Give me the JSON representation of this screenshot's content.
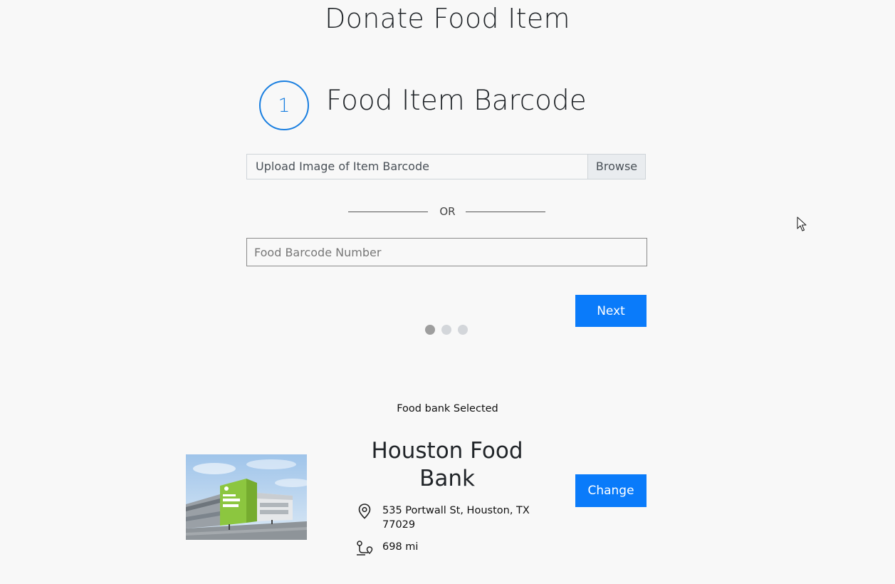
{
  "page": {
    "title": "Donate Food Item"
  },
  "step": {
    "number": "1",
    "title": "Food Item Barcode",
    "upload": {
      "label": "Upload Image of Item Barcode",
      "browse": "Browse"
    },
    "divider": "OR",
    "barcode_input": {
      "placeholder": "Food Barcode Number",
      "value": ""
    },
    "next": "Next",
    "pagination": {
      "total": 3,
      "active": 1
    }
  },
  "foodbank": {
    "selected_label": "Food bank Selected",
    "name": "Houston Food Bank",
    "address": "535 Portwall St, Houston, TX 77029",
    "distance": "698 mi",
    "change": "Change",
    "image_icon": "foodbank-building-photo"
  },
  "icons": {
    "address": "location-pin-icon",
    "distance": "route-icon",
    "cursor": "mouse-cursor-icon"
  },
  "colors": {
    "accent": "#0a7bfa",
    "step_circle": "#1a7fe0",
    "background": "#f8f8f8",
    "building_green": "#8cc63f"
  }
}
